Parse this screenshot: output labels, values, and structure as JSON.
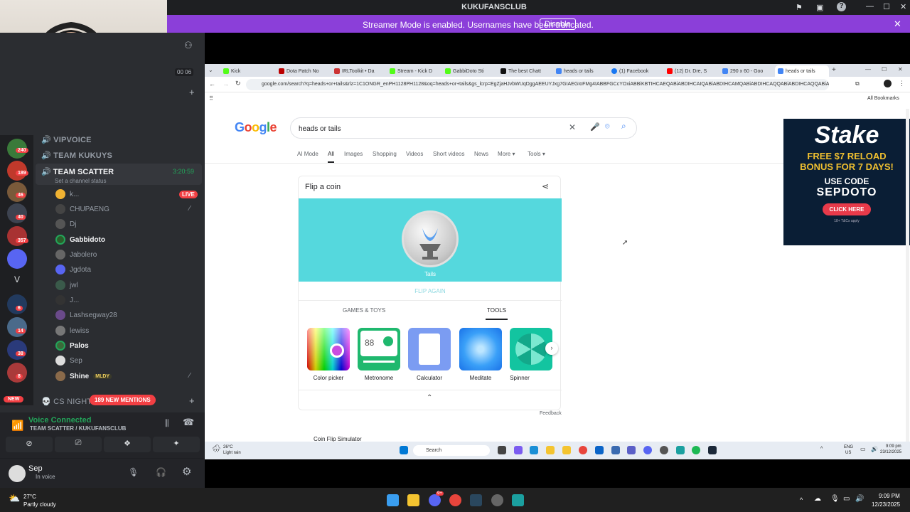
{
  "discord": {
    "window_title": "KUKUFANSCLUB",
    "banner_text": "Streamer Mode is enabled. Usernames have been truncated.",
    "banner_button": "Disable",
    "stream_timer": "00 06",
    "channels": {
      "vip": "VIPVOICE",
      "kukuys": "TEAM KUKUYS",
      "scatter": "TEAM SCATTER",
      "scatter_time": "3:20:59",
      "scatter_status": "Set a channel status",
      "cs_nights": "CS NIGHTS",
      "new_mentions": "189 NEW MENTIONS"
    },
    "users": [
      "k...",
      "CHUPAENG",
      "Dj",
      "Gabbidoto",
      "Jabolero",
      "Jgdota",
      "jwl",
      "J...",
      "Lashsegway28",
      "lewiss",
      "Palos",
      "Sep",
      "Shine"
    ],
    "live_label": "LIVE",
    "shine_tag": "MLDY",
    "server_badges": [
      "240",
      "189",
      "46",
      "40",
      "357",
      "6",
      "14",
      "38",
      "8"
    ],
    "server_letter": "V",
    "new_label": "NEW",
    "voice_connected": "Voice Connected",
    "voice_channel": "TEAM SCATTER / KUKUFANSCLUB",
    "user_name": "Sep",
    "user_status": "In voice"
  },
  "chrome": {
    "tabs": [
      "Kick",
      "Dota Patch No",
      "IRLToolkit • Da",
      "Stream - Kick D",
      "GabbiDoto Sti",
      "The best Chatt",
      "heads or tails",
      "(1) Facebook",
      "(12) Dr. Dre, S",
      "290 x 60 - Goo",
      "heads or tails"
    ],
    "url": "google.com/search?q=heads+or+tails&rlz=1C1ONGR_enPH1128PH1128&oq=heads+or+tails&gs_lcrp=EgZjaHJvbWUqDggAEEUYJxg7GIAEGIoFMg4IABBFGCcYOxiABBiKBTIHCAEQABiABDIHCAIQABiABDIHCAMQABiABDIHCAQQABiABDIHCAQQABiABDIHCAQQ...",
    "bookmarks_label": "All Bookmarks"
  },
  "google": {
    "logo": "Google",
    "query": "heads or tails",
    "tabs": [
      "AI Mode",
      "All",
      "Images",
      "Shopping",
      "Videos",
      "Short videos",
      "News",
      "More ▾",
      "Tools ▾"
    ],
    "card_title": "Flip a coin",
    "coin_result": "Tails",
    "flip_again": "FLIP AGAIN",
    "subtabs": [
      "GAMES & TOYS",
      "TOOLS"
    ],
    "tools": [
      "Color picker",
      "Metronome",
      "Calculator",
      "Meditate",
      "Spinner"
    ],
    "metronome_bpm": "88",
    "feedback": "Feedback",
    "next_result": "Coin Flip Simulator"
  },
  "ad": {
    "brand": "Stake",
    "line1": "FREE $7 RELOAD",
    "line2": "BONUS FOR 7 DAYS!",
    "line3": "USE CODE",
    "code": "SEPDOTO",
    "cta": "CLICK HERE",
    "fine_print": "18+ T&Cs apply"
  },
  "inner_taskbar": {
    "weather_temp": "26°C",
    "weather_desc": "Light rain",
    "search_placeholder": "Search",
    "lang": "ENG",
    "region": "US",
    "time": "9:09 pm",
    "date": "23/12/2025"
  },
  "outer_taskbar": {
    "weather_temp": "27°C",
    "weather_desc": "Partly cloudy",
    "discord_badge": "9+",
    "time": "9:09 PM",
    "date": "12/23/2025"
  },
  "colors": {
    "discord_bg": "#2b2d31",
    "streamer_banner": "#8b3fd9",
    "coin_bg": "#55d8dd",
    "live_red": "#f23f43",
    "voice_green": "#23a55a"
  }
}
